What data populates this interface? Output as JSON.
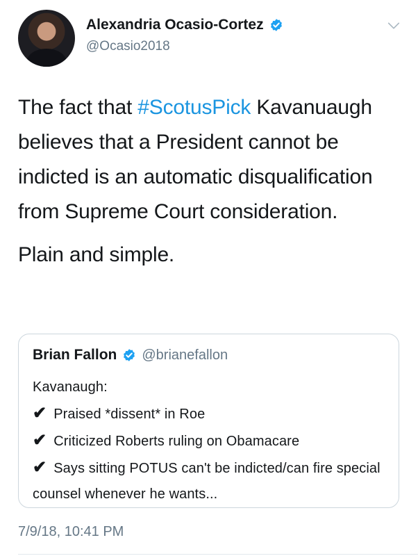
{
  "author": {
    "display_name": "Alexandria Ocasio-Cortez",
    "handle": "@Ocasio2018",
    "verified_icon": "verified-badge-icon"
  },
  "menu_icon": "chevron-down-icon",
  "tweet": {
    "line1_prefix": "The fact that ",
    "hashtag": "#ScotusPick",
    "line1_rest": "Kavanuaugh believes that a President cannot be indicted is an automatic disqualification from Supreme Court consideration.",
    "line2": "Plain and simple."
  },
  "quoted_tweet": {
    "display_name": "Brian Fallon",
    "handle": "@brianefallon",
    "intro": "Kavanaugh:",
    "check_glyph": "✔",
    "items": [
      "Praised *dissent* in Roe",
      "Criticized Roberts ruling on Obamacare",
      "Says sitting POTUS can't be indicted/can fire special counsel whenever he wants..."
    ]
  },
  "timestamp": "7/9/18, 10:41 PM",
  "colors": {
    "link": "#1b95e0",
    "secondary_text": "#657786",
    "border": "#ccd6dd",
    "verified": "#1da1f2"
  }
}
